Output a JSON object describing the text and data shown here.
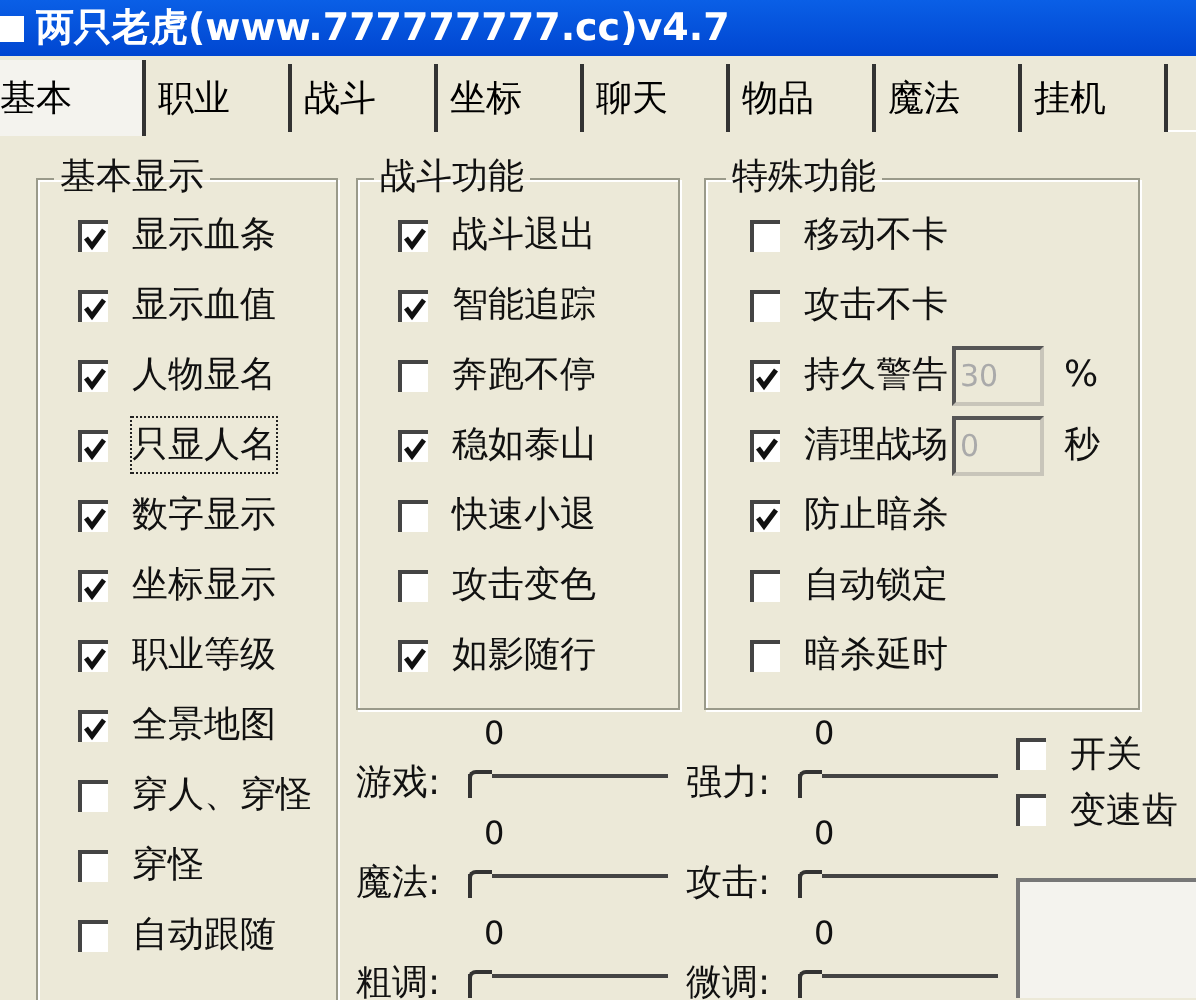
{
  "window": {
    "title": "两只老虎(www.777777777.cc)v4.7"
  },
  "tabs": [
    {
      "label": "基本",
      "selected": true
    },
    {
      "label": "职业",
      "selected": false
    },
    {
      "label": "战斗",
      "selected": false
    },
    {
      "label": "坐标",
      "selected": false
    },
    {
      "label": "聊天",
      "selected": false
    },
    {
      "label": "物品",
      "selected": false
    },
    {
      "label": "魔法",
      "selected": false
    },
    {
      "label": "挂机",
      "selected": false
    }
  ],
  "basic_display": {
    "title": "基本显示",
    "items": [
      {
        "label": "显示血条",
        "checked": true,
        "focused": false
      },
      {
        "label": "显示血值",
        "checked": true,
        "focused": false
      },
      {
        "label": "人物显名",
        "checked": true,
        "focused": false
      },
      {
        "label": "只显人名",
        "checked": true,
        "focused": true
      },
      {
        "label": "数字显示",
        "checked": true,
        "focused": false
      },
      {
        "label": "坐标显示",
        "checked": true,
        "focused": false
      },
      {
        "label": "职业等级",
        "checked": true,
        "focused": false
      },
      {
        "label": "全景地图",
        "checked": true,
        "focused": false
      },
      {
        "label": "穿人、穿怪",
        "checked": false,
        "focused": false
      },
      {
        "label": "穿怪",
        "checked": false,
        "focused": false
      },
      {
        "label": "自动跟随",
        "checked": false,
        "focused": false
      }
    ]
  },
  "combat": {
    "title": "战斗功能",
    "items": [
      {
        "label": "战斗退出",
        "checked": true
      },
      {
        "label": "智能追踪",
        "checked": true
      },
      {
        "label": "奔跑不停",
        "checked": false
      },
      {
        "label": "稳如泰山",
        "checked": true
      },
      {
        "label": "快速小退",
        "checked": false
      },
      {
        "label": "攻击变色",
        "checked": false
      },
      {
        "label": "如影随行",
        "checked": true
      }
    ]
  },
  "special": {
    "title": "特殊功能",
    "items": [
      {
        "label": "移动不卡",
        "checked": false
      },
      {
        "label": "攻击不卡",
        "checked": false
      },
      {
        "label": "持久警告",
        "checked": true,
        "field": {
          "value": "30",
          "disabled": true
        },
        "unit": "%"
      },
      {
        "label": "清理战场",
        "checked": true,
        "field": {
          "value": "0",
          "disabled": true
        },
        "unit": "秒"
      },
      {
        "label": "防止暗杀",
        "checked": true
      },
      {
        "label": "自动锁定",
        "checked": false
      },
      {
        "label": "暗杀延时",
        "checked": false
      }
    ]
  },
  "sliders": [
    {
      "label": "游戏:",
      "reading": "0",
      "level": 0
    },
    {
      "label": "强力:",
      "reading": "0",
      "level": 0
    },
    {
      "label": "魔法:",
      "reading": "0",
      "level": 0
    },
    {
      "label": "攻击:",
      "reading": "0",
      "level": 0
    },
    {
      "label": "粗调:",
      "reading": "0",
      "level": 0
    },
    {
      "label": "微调:",
      "reading": "0",
      "level": 0
    }
  ],
  "side_options": [
    {
      "label": "开关",
      "checked": false
    },
    {
      "label": "变速齿",
      "checked": false
    }
  ]
}
